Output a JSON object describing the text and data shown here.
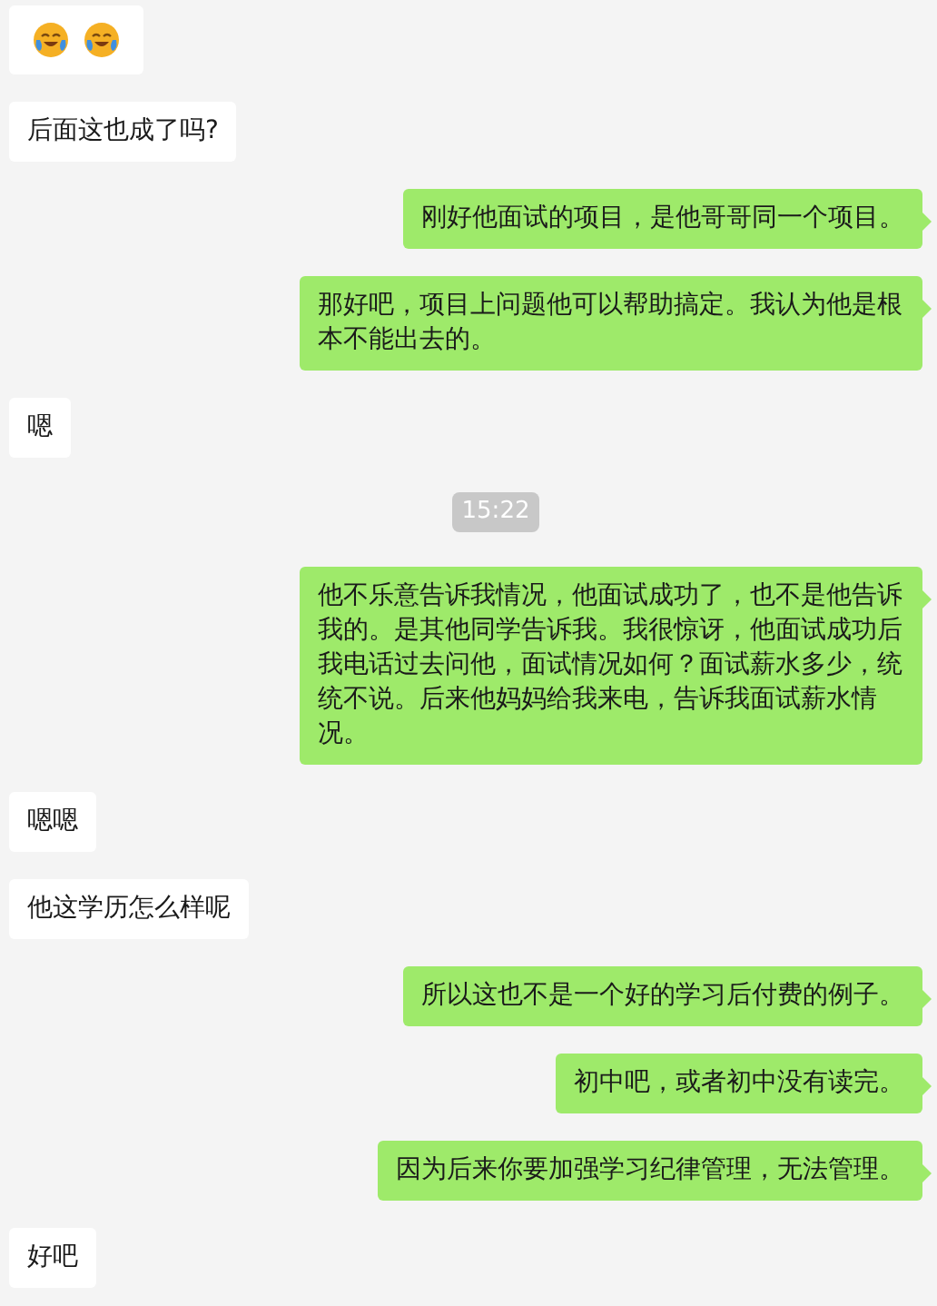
{
  "messages": [
    {
      "kind": "sticker",
      "outgoing": false,
      "stickers": [
        {
          "kind": "crying-laugh"
        },
        {
          "kind": "crying-laugh"
        }
      ]
    },
    {
      "kind": "text",
      "outgoing": false,
      "text": "后面这也成了吗?"
    },
    {
      "kind": "text",
      "outgoing": true,
      "text": "刚好他面试的项目，是他哥哥同一个项目。"
    },
    {
      "kind": "text",
      "outgoing": true,
      "text": "那好吧，项目上问题他可以帮助搞定。我认为他是根本不能出去的。"
    },
    {
      "kind": "text",
      "outgoing": false,
      "text": "嗯"
    },
    {
      "kind": "time",
      "text": "15:22"
    },
    {
      "kind": "text",
      "outgoing": true,
      "text": "他不乐意告诉我情况，他面试成功了，也不是他告诉我的。是其他同学告诉我。我很惊讶，他面试成功后我电话过去问他，面试情况如何？面试薪水多少，统统不说。后来他妈妈给我来电，告诉我面试薪水情况。"
    },
    {
      "kind": "text",
      "outgoing": false,
      "text": "嗯嗯"
    },
    {
      "kind": "text",
      "outgoing": false,
      "text": "他这学历怎么样呢"
    },
    {
      "kind": "text",
      "outgoing": true,
      "text": "所以这也不是一个好的学习后付费的例子。"
    },
    {
      "kind": "text",
      "outgoing": true,
      "text": "初中吧，或者初中没有读完。"
    },
    {
      "kind": "text",
      "outgoing": true,
      "text": "因为后来你要加强学习纪律管理，无法管理。"
    },
    {
      "kind": "text",
      "outgoing": false,
      "text": "好吧"
    }
  ]
}
